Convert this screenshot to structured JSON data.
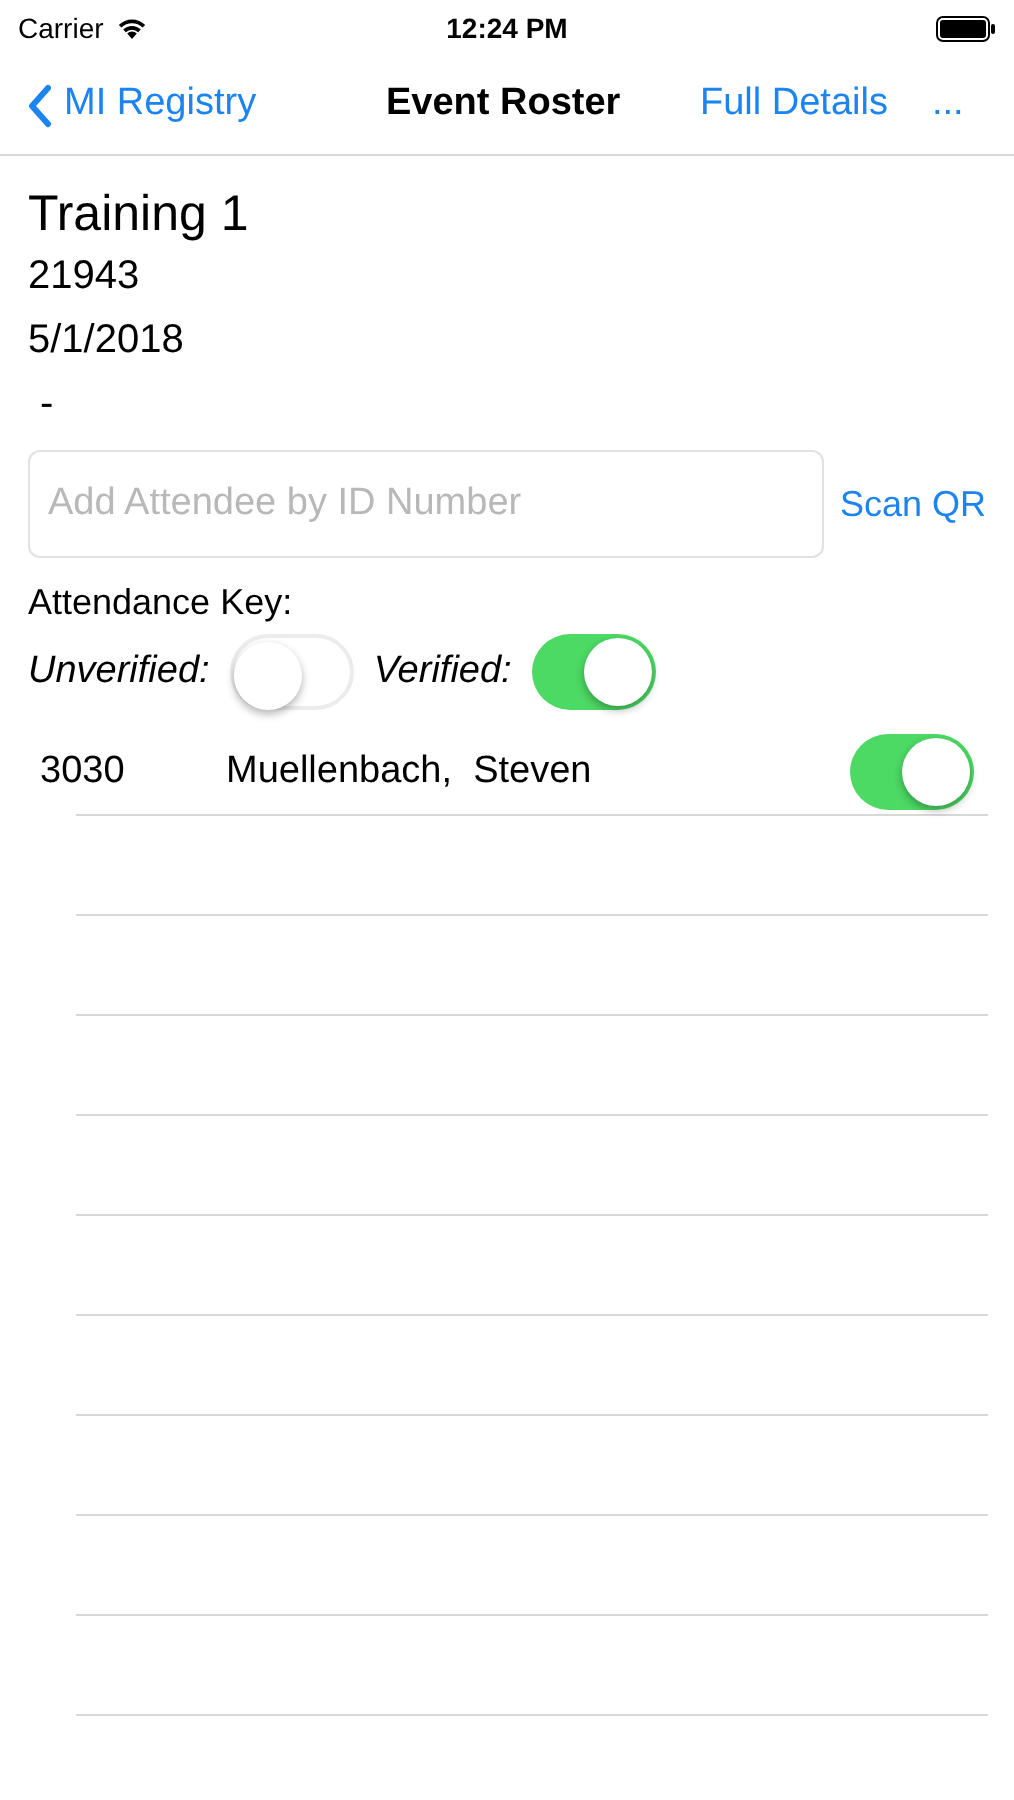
{
  "status_bar": {
    "carrier": "Carrier",
    "time": "12:24 PM"
  },
  "nav_bar": {
    "back": "MI Registry",
    "title": "Event Roster",
    "action": "Full Details",
    "more": "..."
  },
  "event": {
    "name": "Training 1",
    "id": "21943",
    "date": "5/1/2018",
    "extra": "-"
  },
  "attendee_field": {
    "placeholder": "Add Attendee by ID Number"
  },
  "scan_button": "Scan QR",
  "attendance_key": {
    "label": "Attendance Key:",
    "items": [
      {
        "label": "Unverified:",
        "on": false
      },
      {
        "label": "Verified:",
        "on": true
      }
    ]
  },
  "attendees": [
    {
      "id": "3030",
      "name": "Muellenbach,  Steven",
      "on": true
    }
  ]
}
